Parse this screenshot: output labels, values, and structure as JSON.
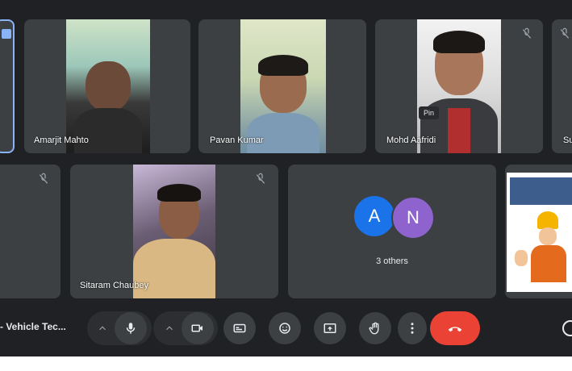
{
  "participants": [
    {
      "name": "Amarjit Mahto"
    },
    {
      "name": "Pavan Kumar"
    },
    {
      "name": "Mohd Aafridi"
    },
    {
      "name": "Su"
    },
    {
      "name": "Sitaram Chaubey"
    }
  ],
  "others": {
    "avatar1": "A",
    "avatar2": "N",
    "label": "3 others",
    "color1": "#1a73e8",
    "color2": "#8e63ce"
  },
  "tooltip": {
    "pin": "Pin"
  },
  "meeting": {
    "title": "- Vehicle Tec..."
  },
  "colors": {
    "end_call": "#ea4335",
    "active_border": "#8ab4f8",
    "tile_bg": "#3c4043"
  }
}
